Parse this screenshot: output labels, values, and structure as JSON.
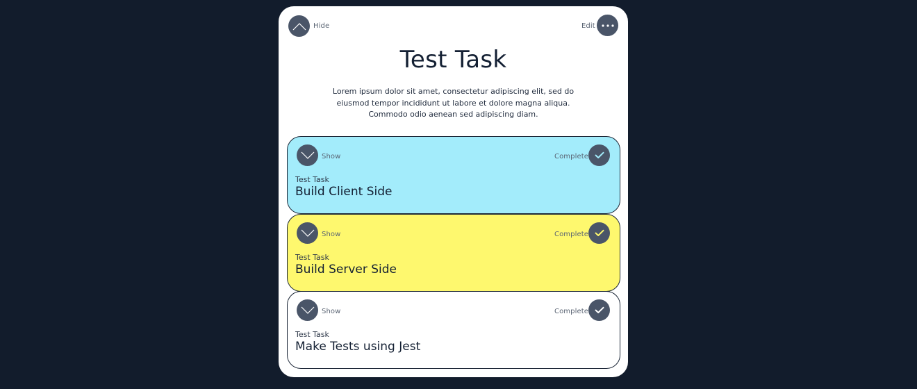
{
  "header": {
    "hide_label": "Hide",
    "edit_label": "Edit",
    "hide_icon": "chevron-up-icon",
    "edit_icon": "more-horizontal-icon"
  },
  "task": {
    "title": "Test Task",
    "description": "Lorem ipsum dolor sit amet, consectetur adipiscing elit, sed do eiusmod tempor incididunt ut labore et dolore magna aliqua. Commodo odio aenean sed adipiscing diam."
  },
  "subtasks": [
    {
      "show_label": "Show",
      "complete_label": "Complete",
      "project": "Test Task",
      "name": "Build Client Side",
      "color": "#a3ecfb",
      "check_color": "#a3ecfb"
    },
    {
      "show_label": "Show",
      "complete_label": "Complete",
      "project": "Test Task",
      "name": "Build Server Side",
      "color": "#fef86e",
      "check_color": "#fef86e"
    },
    {
      "show_label": "Show",
      "complete_label": "Complete",
      "project": "Test Task",
      "name": "Make Tests using Jest",
      "color": "#ffffff",
      "check_color": "#ffffff"
    }
  ],
  "colors": {
    "background": "#121c2c",
    "card": "#ffffff",
    "button": "#4a5568",
    "text": "#142033"
  }
}
